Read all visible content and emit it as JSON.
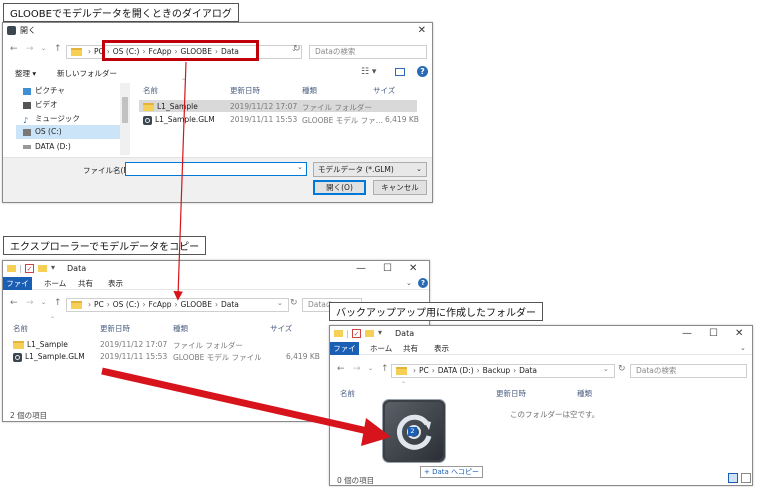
{
  "captions": {
    "open_dialog": "GLOOBEでモデルデータを開くときのダイアログ",
    "explorer_copy": "エクスプローラーでモデルデータをコピー",
    "backup_folder": "バックアップアップ用に作成したフォルダー"
  },
  "dialog": {
    "title": "開く",
    "address": [
      "PC",
      "OS (C:)",
      "FcApp",
      "GLOOBE",
      "Data"
    ],
    "search_placeholder": "Dataの検索",
    "organize": "整理 ▾",
    "new_folder": "新しいフォルダー",
    "tree": [
      "ピクチャ",
      "ビデオ",
      "ミュージック",
      "OS (C:)",
      "DATA (D:)"
    ],
    "columns": [
      "名前",
      "更新日時",
      "種類",
      "サイズ"
    ],
    "files": [
      {
        "name": "L1_Sample",
        "date": "2019/11/12 17:07",
        "type": "ファイル フォルダー",
        "size": ""
      },
      {
        "name": "L1_Sample.GLM",
        "date": "2019/11/11 15:53",
        "type": "GLOOBE モデル ファ...",
        "size": "6,419 KB"
      }
    ],
    "filename_label": "ファイル名(N):",
    "filename_value": "",
    "filetype": "モデルデータ (*.GLM)",
    "open_button": "開く(O)",
    "cancel_button": "キャンセル"
  },
  "explorer1": {
    "title": "Data",
    "ribbon_file": "ファイル",
    "ribbon_tabs": [
      "ホーム",
      "共有",
      "表示"
    ],
    "address": [
      "PC",
      "OS (C:)",
      "FcApp",
      "GLOOBE",
      "Data"
    ],
    "search_placeholder": "Dataの",
    "columns": [
      "名前",
      "更新日時",
      "種類",
      "サイズ"
    ],
    "files": [
      {
        "name": "L1_Sample",
        "date": "2019/11/12 17:07",
        "type": "ファイル フォルダー",
        "size": ""
      },
      {
        "name": "L1_Sample.GLM",
        "date": "2019/11/11 15:53",
        "type": "GLOOBE モデル ファイル",
        "size": "6,419 KB"
      }
    ],
    "status": "2 個の項目"
  },
  "explorer2": {
    "title": "Data",
    "ribbon_file": "ファイル",
    "ribbon_tabs": [
      "ホーム",
      "共有",
      "表示"
    ],
    "address": [
      "PC",
      "DATA (D:)",
      "Backup",
      "Data"
    ],
    "search_placeholder": "Dataの検索",
    "columns": [
      "名前",
      "更新日時",
      "種類"
    ],
    "empty_text": "このフォルダーは空です。",
    "drag_tooltip": "+ Data へコピー",
    "drag_badge": "2",
    "status": "0 個の項目"
  },
  "colors": {
    "highlight_box": "#c0000b",
    "arrow": "#d7141b",
    "accent": "#1a5fb4"
  }
}
